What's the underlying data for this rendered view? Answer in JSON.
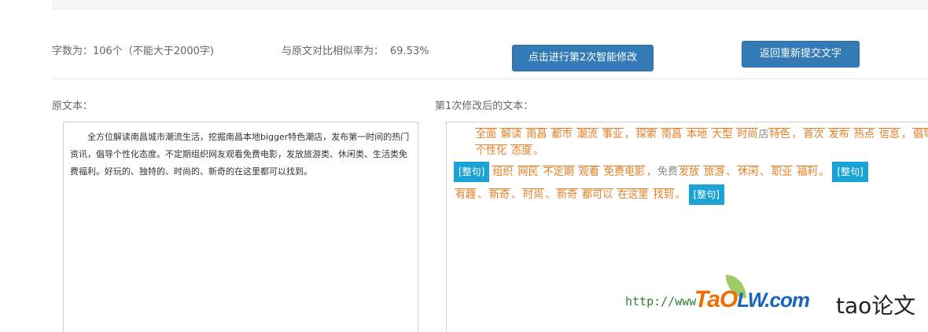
{
  "stats": {
    "word_count_label": "字数为：",
    "word_count_value": "106个（不能大于2000字)",
    "similarity_label": "与原文对比相似率为：",
    "similarity_value": "69.53%"
  },
  "buttons": {
    "second_modify": "点击进行第2次智能修改",
    "back_resubmit": "返回重新提交文字"
  },
  "original": {
    "label": "原文本：",
    "text": "全方位解读南昌城市潮流生活，挖掘南昌本地bigger特色潮店，发布第一时间的热门资讯，倡导个性化态度。不定期组织网友观看免费电影，发放旅游类、休闲类、生活类免费福利。好玩的、独特的、时尚的、新奇的在这里都可以找到。"
  },
  "modified": {
    "label": "第1次修改后的文本：",
    "line1": [
      {
        "t": "全面"
      },
      {
        "t": " "
      },
      {
        "t": "解读"
      },
      {
        "t": " "
      },
      {
        "t": "南昌"
      },
      {
        "t": " "
      },
      {
        "t": "都市"
      },
      {
        "t": " "
      },
      {
        "t": "潮流"
      },
      {
        "t": " "
      },
      {
        "t": "事业"
      },
      {
        "t": "，",
        "plain": true
      },
      {
        "t": "探索"
      },
      {
        "t": " "
      },
      {
        "t": "南昌"
      },
      {
        "t": " "
      },
      {
        "t": "本地"
      },
      {
        "t": " "
      },
      {
        "t": "大型"
      },
      {
        "t": " "
      },
      {
        "t": "时尚"
      },
      {
        "t": "店",
        "gray": true
      },
      {
        "t": "特色"
      },
      {
        "t": "，",
        "plain": true
      },
      {
        "t": "首次"
      },
      {
        "t": " "
      },
      {
        "t": "发布"
      },
      {
        "t": " "
      },
      {
        "t": "热点"
      },
      {
        "t": " "
      },
      {
        "t": "信息"
      },
      {
        "t": "，",
        "plain": true
      },
      {
        "t": "倡导"
      }
    ],
    "line2": [
      {
        "t": "个性化"
      },
      {
        "t": " "
      },
      {
        "t": "态度"
      },
      {
        "t": "。",
        "plain": true
      }
    ],
    "tag": "[整句]",
    "line3": [
      {
        "t": "组织"
      },
      {
        "t": " "
      },
      {
        "t": "网民"
      },
      {
        "t": " "
      },
      {
        "t": "不定期"
      },
      {
        "t": " "
      },
      {
        "t": "观看"
      },
      {
        "t": " "
      },
      {
        "t": "免费电影"
      },
      {
        "t": "，",
        "plain": true
      },
      {
        "t": "免费",
        "gray": true
      },
      {
        "t": "发放"
      },
      {
        "t": " "
      },
      {
        "t": "旅游"
      },
      {
        "t": "、",
        "plain": true
      },
      {
        "t": "休闲"
      },
      {
        "t": "、",
        "plain": true
      },
      {
        "t": "职业"
      },
      {
        "t": " "
      },
      {
        "t": "福利"
      },
      {
        "t": "。",
        "plain": true
      }
    ],
    "line4": [
      {
        "t": "有趣"
      },
      {
        "t": "、",
        "plain": true
      },
      {
        "t": "新奇"
      },
      {
        "t": "、",
        "plain": true
      },
      {
        "t": "时尚"
      },
      {
        "t": "、",
        "plain": true
      },
      {
        "t": "新奇"
      },
      {
        "t": " "
      },
      {
        "t": "都可以"
      },
      {
        "t": " "
      },
      {
        "t": "在这里"
      },
      {
        "t": " "
      },
      {
        "t": "找到"
      },
      {
        "t": "。",
        "plain": true
      }
    ]
  },
  "watermark": {
    "url": "http://www.",
    "logo_tao": "TaO",
    "logo_lw": "LW.com",
    "cn": "tao论文"
  },
  "colors": {
    "button_bg": "#337ab7",
    "changed_word": "#e67e22",
    "tag_bg": "#1aa3d4"
  }
}
